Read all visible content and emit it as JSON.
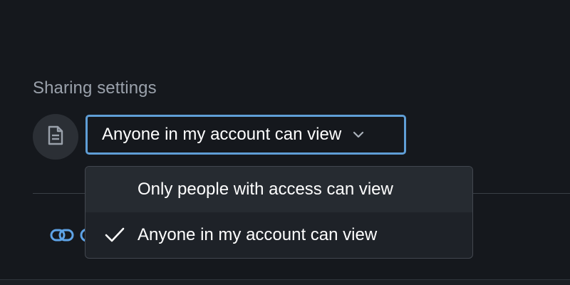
{
  "sharing": {
    "section_label": "Sharing settings",
    "selected_value": "Anyone in my account can view",
    "options": [
      {
        "label": "Only people with access can view",
        "selected": false
      },
      {
        "label": "Anyone in my account can view",
        "selected": true
      }
    ]
  },
  "icons": {
    "avatar": "document-icon",
    "select_chevron": "chevron-down-icon",
    "selected_check": "checkmark-icon",
    "link": "link-icon"
  },
  "colors": {
    "background": "#15181d",
    "focus_border": "#5f9ed6",
    "link_accent": "#5ea3e6",
    "menu_background": "#1e2228",
    "hover_background": "#262b31"
  }
}
